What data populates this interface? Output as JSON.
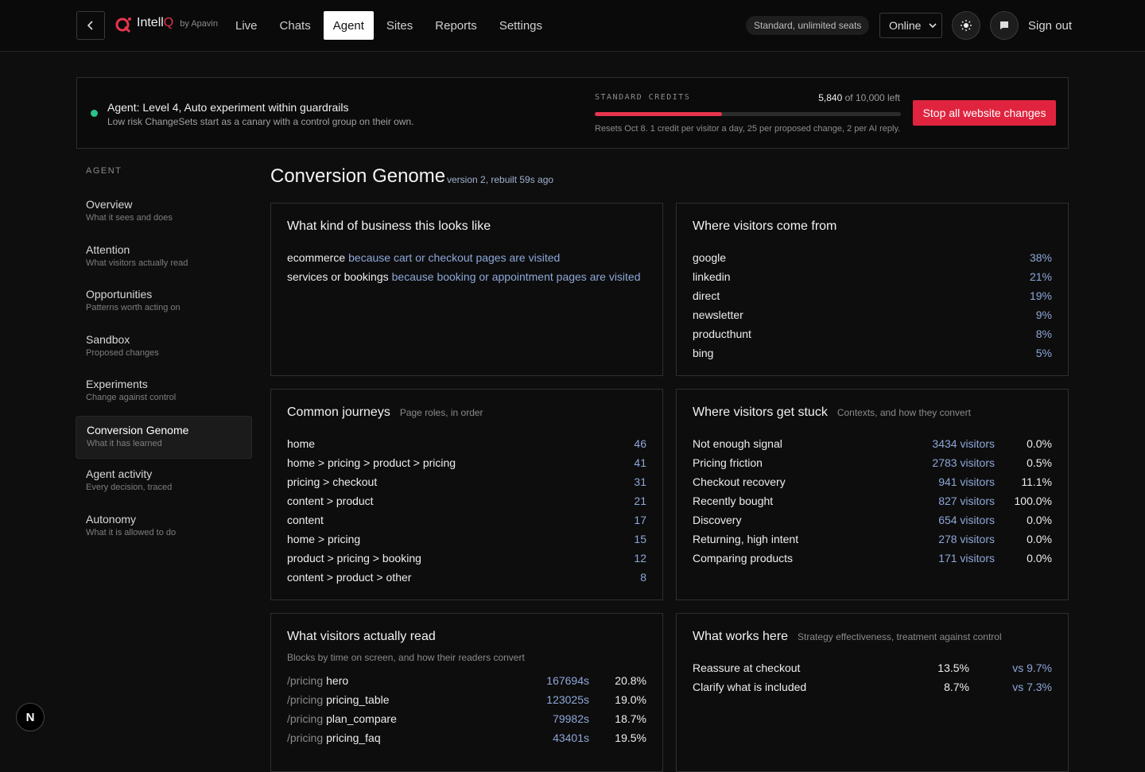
{
  "header": {
    "brand_name": "Intell",
    "brand_q": "Q",
    "brand_by": "by Apavin",
    "nav": [
      {
        "label": "Live",
        "active": false
      },
      {
        "label": "Chats",
        "active": false
      },
      {
        "label": "Agent",
        "active": true
      },
      {
        "label": "Sites",
        "active": false
      },
      {
        "label": "Reports",
        "active": false
      },
      {
        "label": "Settings",
        "active": false
      }
    ],
    "seats": "Standard, unlimited seats",
    "status": "Online",
    "sign_out": "Sign out"
  },
  "banner": {
    "title": "Agent: Level 4, Auto experiment within guardrails",
    "subtitle": "Low risk ChangeSets start as a canary with a control group on their own.",
    "credits_label": "STANDARD CREDITS",
    "credits_left": "5,840",
    "credits_total": " of 10,000 left",
    "credits_used_fraction": 0.416,
    "credits_note": "Resets Oct 8. 1 credit per visitor a day, 25 per proposed change, 2 per AI reply.",
    "stop_label": "Stop all website changes"
  },
  "sidebar": {
    "heading": "AGENT",
    "items": [
      {
        "label": "Overview",
        "desc": "What it sees and does",
        "active": false
      },
      {
        "label": "Attention",
        "desc": "What visitors actually read",
        "active": false
      },
      {
        "label": "Opportunities",
        "desc": "Patterns worth acting on",
        "active": false
      },
      {
        "label": "Sandbox",
        "desc": "Proposed changes",
        "active": false
      },
      {
        "label": "Experiments",
        "desc": "Change against control",
        "active": false
      },
      {
        "label": "Conversion Genome",
        "desc": "What it has learned",
        "active": true
      },
      {
        "label": "Agent activity",
        "desc": "Every decision, traced",
        "active": false
      },
      {
        "label": "Autonomy",
        "desc": "What it is allowed to do",
        "active": false
      }
    ]
  },
  "main": {
    "title": "Conversion Genome",
    "subtitle": "version 2, rebuilt 59s ago",
    "business": {
      "title": "What kind of business this looks like",
      "rows": [
        {
          "type": "ecommerce",
          "reason": "because cart or checkout pages are visited"
        },
        {
          "type": "services or bookings",
          "reason": "because booking or appointment pages are visited"
        }
      ]
    },
    "sources": {
      "title": "Where visitors come from",
      "rows": [
        {
          "name": "google",
          "pct": "38%"
        },
        {
          "name": "linkedin",
          "pct": "21%"
        },
        {
          "name": "direct",
          "pct": "19%"
        },
        {
          "name": "newsletter",
          "pct": "9%"
        },
        {
          "name": "producthunt",
          "pct": "8%"
        },
        {
          "name": "bing",
          "pct": "5%"
        }
      ]
    },
    "journeys": {
      "title": "Common journeys",
      "hint": "Page roles, in order",
      "rows": [
        {
          "path": "home",
          "count": "46"
        },
        {
          "path": "home > pricing > product > pricing",
          "count": "41"
        },
        {
          "path": "pricing > checkout",
          "count": "31"
        },
        {
          "path": "content > product",
          "count": "21"
        },
        {
          "path": "content",
          "count": "17"
        },
        {
          "path": "home > pricing",
          "count": "15"
        },
        {
          "path": "product > pricing > booking",
          "count": "12"
        },
        {
          "path": "content > product > other",
          "count": "8"
        }
      ]
    },
    "stuck": {
      "title": "Where visitors get stuck",
      "hint": "Contexts, and how they convert",
      "rows": [
        {
          "name": "Not enough signal",
          "visitors": "3434 visitors",
          "rate": "0.0%"
        },
        {
          "name": "Pricing friction",
          "visitors": "2783 visitors",
          "rate": "0.5%"
        },
        {
          "name": "Checkout recovery",
          "visitors": "941 visitors",
          "rate": "11.1%"
        },
        {
          "name": "Recently bought",
          "visitors": "827 visitors",
          "rate": "100.0%"
        },
        {
          "name": "Discovery",
          "visitors": "654 visitors",
          "rate": "0.0%"
        },
        {
          "name": "Returning, high intent",
          "visitors": "278 visitors",
          "rate": "0.0%"
        },
        {
          "name": "Comparing products",
          "visitors": "171 visitors",
          "rate": "0.0%"
        }
      ]
    },
    "read": {
      "title": "What visitors actually read",
      "subtitle": "Blocks by time on screen, and how their readers convert",
      "rows": [
        {
          "page": "/pricing",
          "block": "hero",
          "time": "167694s",
          "rate": "20.8%"
        },
        {
          "page": "/pricing",
          "block": "pricing_table",
          "time": "123025s",
          "rate": "19.0%"
        },
        {
          "page": "/pricing",
          "block": "plan_compare",
          "time": "79982s",
          "rate": "18.7%"
        },
        {
          "page": "/pricing",
          "block": "pricing_faq",
          "time": "43401s",
          "rate": "19.5%"
        }
      ]
    },
    "works": {
      "title": "What works here",
      "hint": "Strategy effectiveness, treatment against control",
      "rows": [
        {
          "name": "Reassure at checkout",
          "treatment": "13.5%",
          "control": "vs 9.7%"
        },
        {
          "name": "Clarify what is included",
          "treatment": "8.7%",
          "control": "vs 7.3%"
        }
      ]
    }
  },
  "footer": {
    "logo_letter": "N"
  }
}
